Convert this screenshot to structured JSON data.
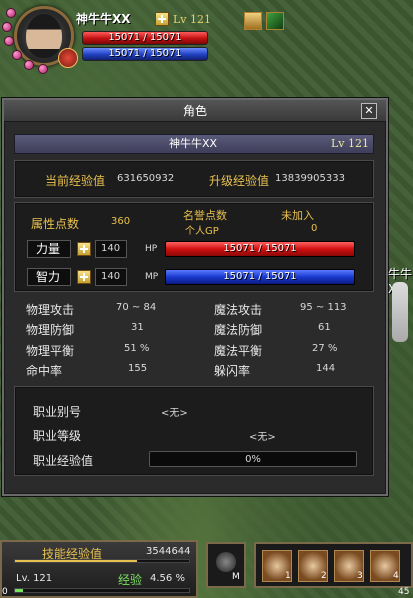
{
  "player": {
    "name": "神牛牛XX",
    "level": "Lv 121",
    "hp_text": "15071 / 15071",
    "mp_text": "15071 / 15071"
  },
  "window": {
    "title": "角色",
    "close_label": "✕",
    "char_name": "神牛牛XX",
    "char_level": "Lv 121",
    "current_exp_label": "当前经验值",
    "current_exp_value": "631650932",
    "upgrade_exp_label": "升级经验值",
    "upgrade_exp_value": "13839905333",
    "attr_points_label": "属性点数",
    "attr_points_value": "360",
    "fame_label": "名誉点数",
    "personal_gp_label": "个人GP",
    "not_joined_label": "未加入",
    "gp_value": "0",
    "strength_label": "力量",
    "strength_value": "140",
    "hp_tag": "HP",
    "hp_text": "15071 / 15071",
    "intellect_label": "智力",
    "intellect_value": "140",
    "mp_tag": "MP",
    "mp_text": "15071 / 15071",
    "stats": [
      {
        "label": "物理攻击",
        "value": "70 ~ 84",
        "label2": "魔法攻击",
        "value2": "95 ~ 113"
      },
      {
        "label": "物理防御",
        "value": "31",
        "label2": "魔法防御",
        "value2": "61"
      },
      {
        "label": "物理平衡",
        "value": "51 %",
        "label2": "魔法平衡",
        "value2": "27 %"
      },
      {
        "label": "命中率",
        "value": "155",
        "label2": "躲闪率",
        "value2": "144"
      }
    ],
    "job_title_label": "职业别号",
    "job_title_value": "<无>",
    "job_level_label": "职业等级",
    "job_level_value": "<无>",
    "job_exp_label": "职业经验值",
    "job_exp_value": "0%"
  },
  "side_text": "牛牛X",
  "hud": {
    "skill_exp_label": "技能经验值",
    "skill_exp_value": "3544644",
    "level": "Lv. 121",
    "exp_label": "经验",
    "exp_value": "4.56 %",
    "exp_fraction": 0.0456,
    "slot_keys": [
      "M",
      "1",
      "2",
      "3",
      "4"
    ],
    "corner_left": "0",
    "corner_right": "45"
  }
}
